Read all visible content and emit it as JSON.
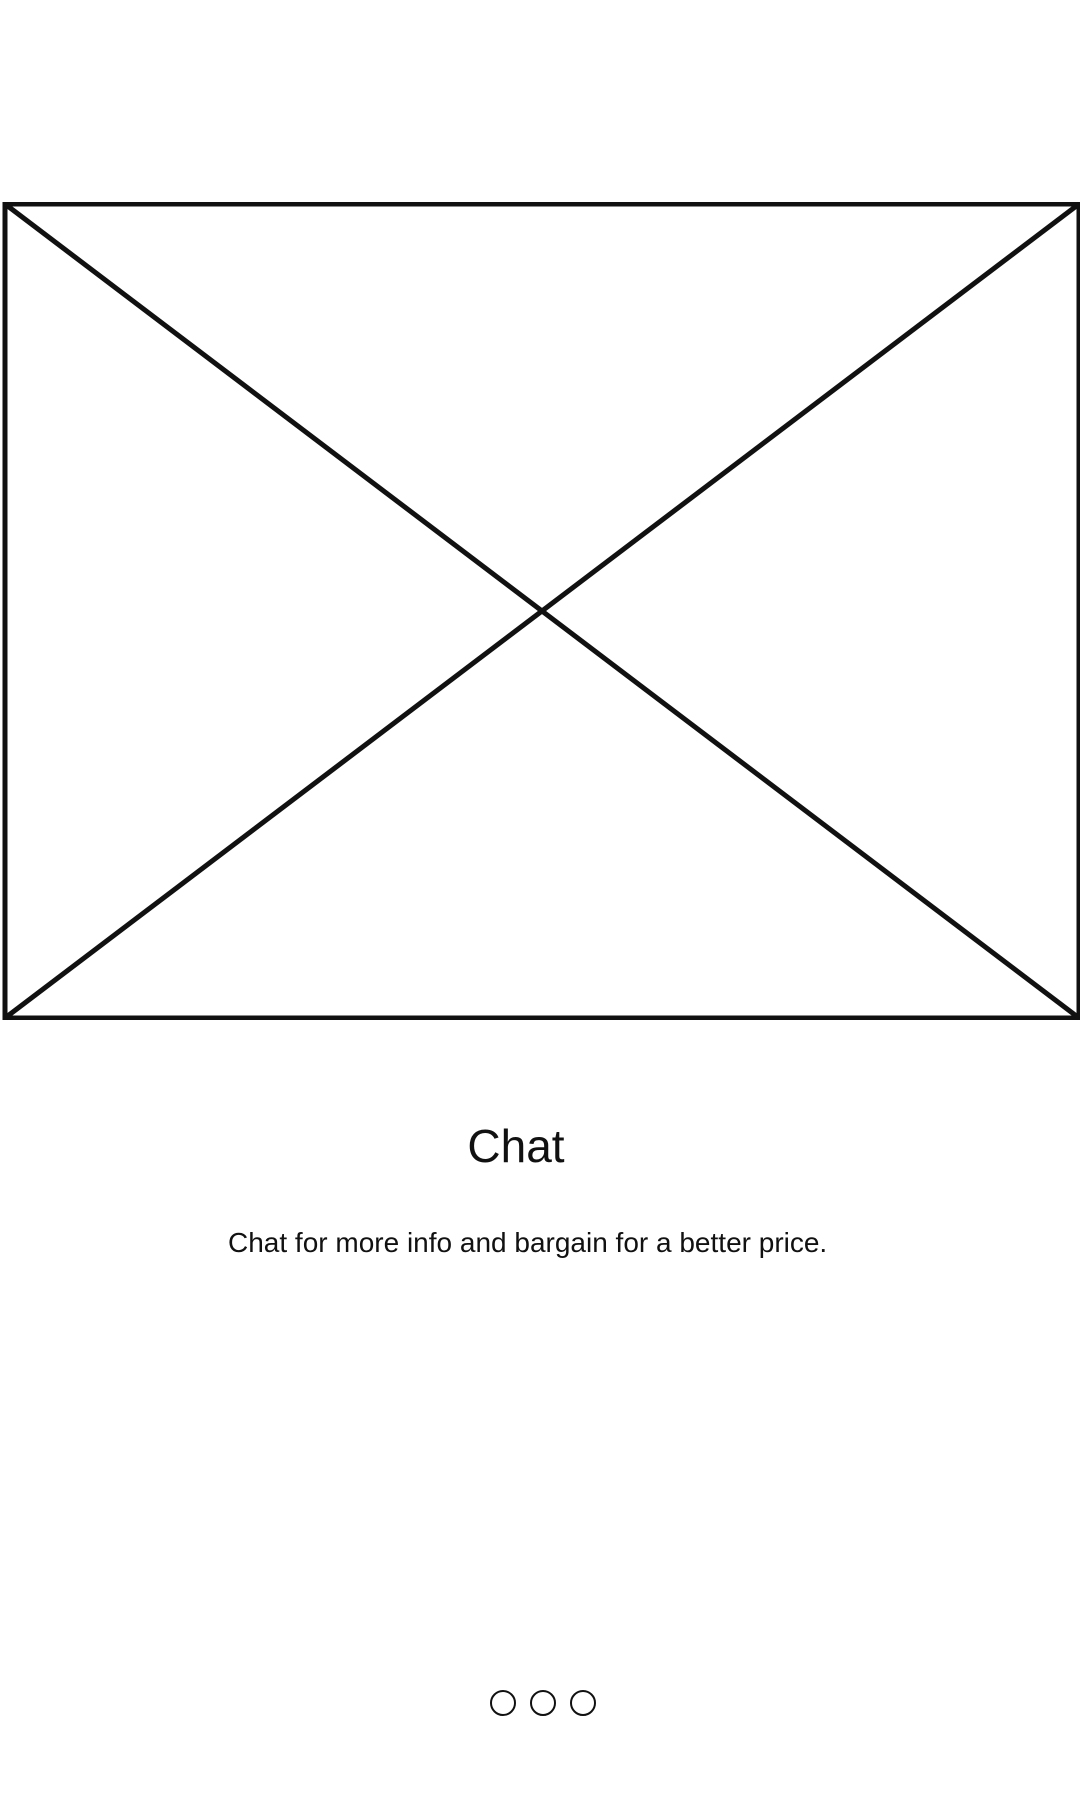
{
  "onboarding": {
    "image": {
      "icon": "image-placeholder-icon"
    },
    "title": "Chat",
    "description": "Chat for more info and bargain for a better price.",
    "pagination": {
      "total_pages": 3,
      "dot_icon": "circle-outline-icon"
    }
  }
}
